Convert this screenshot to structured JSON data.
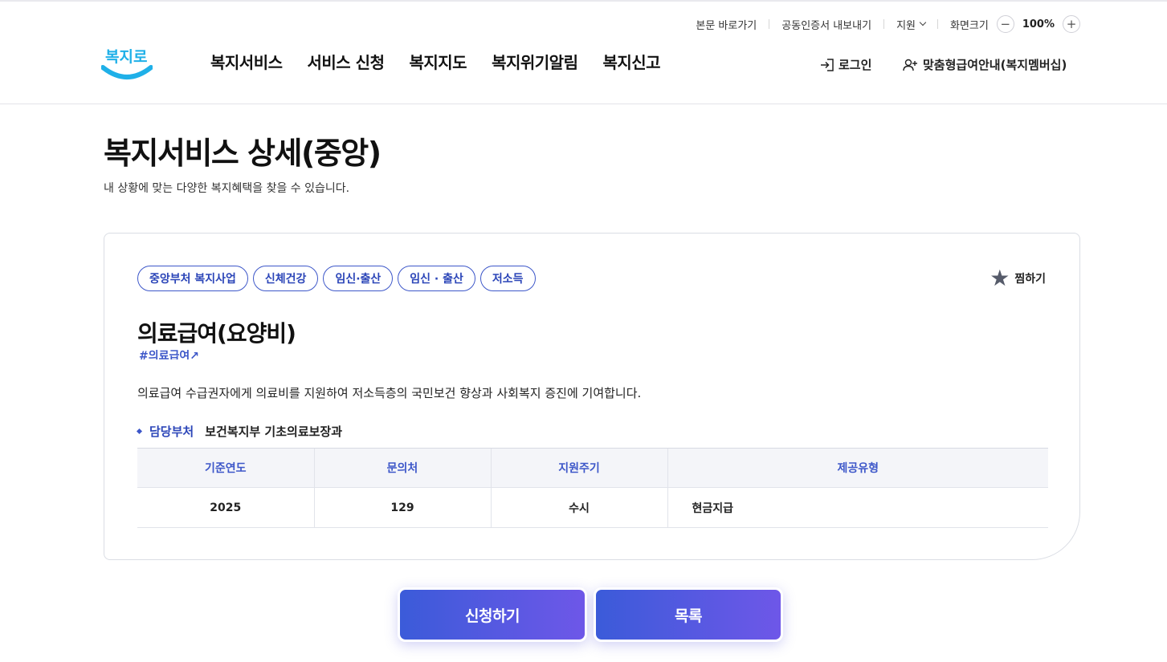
{
  "utility": {
    "skip_content": "본문 바로가기",
    "cert_export": "공동인증서 내보내기",
    "support": "지원",
    "screen_size": "화면크기",
    "zoom_minus": "−",
    "zoom_value": "100%",
    "zoom_plus": "+"
  },
  "logo_text": "복지로",
  "nav": {
    "items": [
      "복지서비스",
      "서비스 신청",
      "복지지도",
      "복지위기알림",
      "복지신고"
    ]
  },
  "header_actions": {
    "login": "로그인",
    "membership": "맞춤형급여안내(복지멤버십)"
  },
  "page": {
    "title": "복지서비스 상세(중앙)",
    "subtitle": "내 상황에 맞는 다양한 복지혜택을 찾을 수 있습니다."
  },
  "service": {
    "tags": [
      "중앙부처 복지사업",
      "신체건강",
      "임신·출산",
      "임신 · 출산",
      "저소득"
    ],
    "favorite_label": "찜하기",
    "title": "의료급여(요양비)",
    "hashtag": "#의료급여",
    "description": "의료급여 수급권자에게 의료비를 지원하여 저소득층의 국민보건 향상과 사회복지 증진에 기여합니다.",
    "dept_label": "담당부처",
    "dept_value": "보건복지부 기초의료보장과",
    "table": {
      "headers": [
        "기준연도",
        "문의처",
        "지원주기",
        "제공유형"
      ],
      "row": [
        "2025",
        "129",
        "수시",
        "현금지급"
      ]
    }
  },
  "buttons": {
    "apply": "신청하기",
    "list": "목록"
  },
  "colors": {
    "accent": "#3d57c9",
    "logo_blue": "#1fb0e8",
    "button_gradient_start": "#3b5bd9",
    "button_gradient_end": "#6e57e8"
  }
}
